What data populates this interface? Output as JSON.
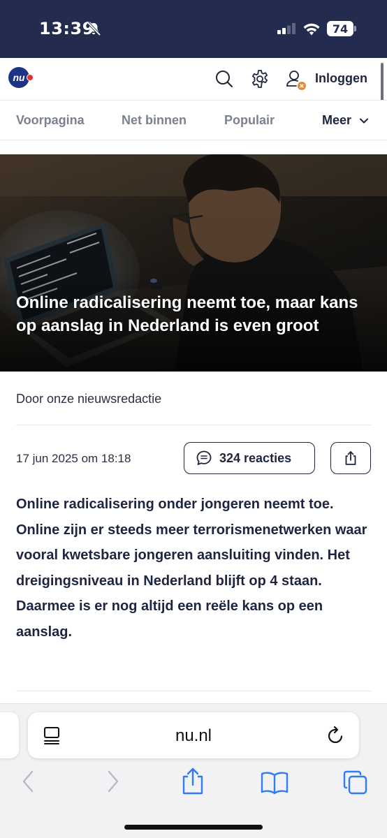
{
  "status_bar": {
    "time": "13:39",
    "battery": "74",
    "icons": [
      "bell-slash-icon",
      "cellular-signal-icon",
      "wifi-icon",
      "battery-icon"
    ]
  },
  "header": {
    "logo_text": "nu",
    "login_label": "Inloggen",
    "icons": [
      "search-icon",
      "gear-icon",
      "user-icon"
    ],
    "brand_color": "#1e3483",
    "accent_color": "#e3322b"
  },
  "nav": {
    "tabs": [
      {
        "label": "Voorpagina"
      },
      {
        "label": "Net binnen"
      },
      {
        "label": "Populair"
      },
      {
        "label": "Meer"
      }
    ]
  },
  "article": {
    "title": "Online radicalisering neemt toe, maar kans op aanslag in Nederland is even groot",
    "byline": "Door onze nieuwsredactie",
    "date": "17 jun 2025 om 18:18",
    "comments_label": "324 reacties",
    "lead": "Online radicalisering onder jongeren neemt toe. Online zijn er steeds meer terrorismenetwerken waar vooral kwetsbare jongeren aansluiting vinden. Het dreigingsniveau in Nederland blijft op 4 staan. Daarmee is er nog altijd een reële kans op een aanslag."
  },
  "browser": {
    "url": "nu.nl",
    "icons": [
      "reader-icon",
      "reload-icon",
      "back-icon",
      "forward-icon",
      "share-icon",
      "bookmarks-icon",
      "tabs-icon"
    ]
  }
}
